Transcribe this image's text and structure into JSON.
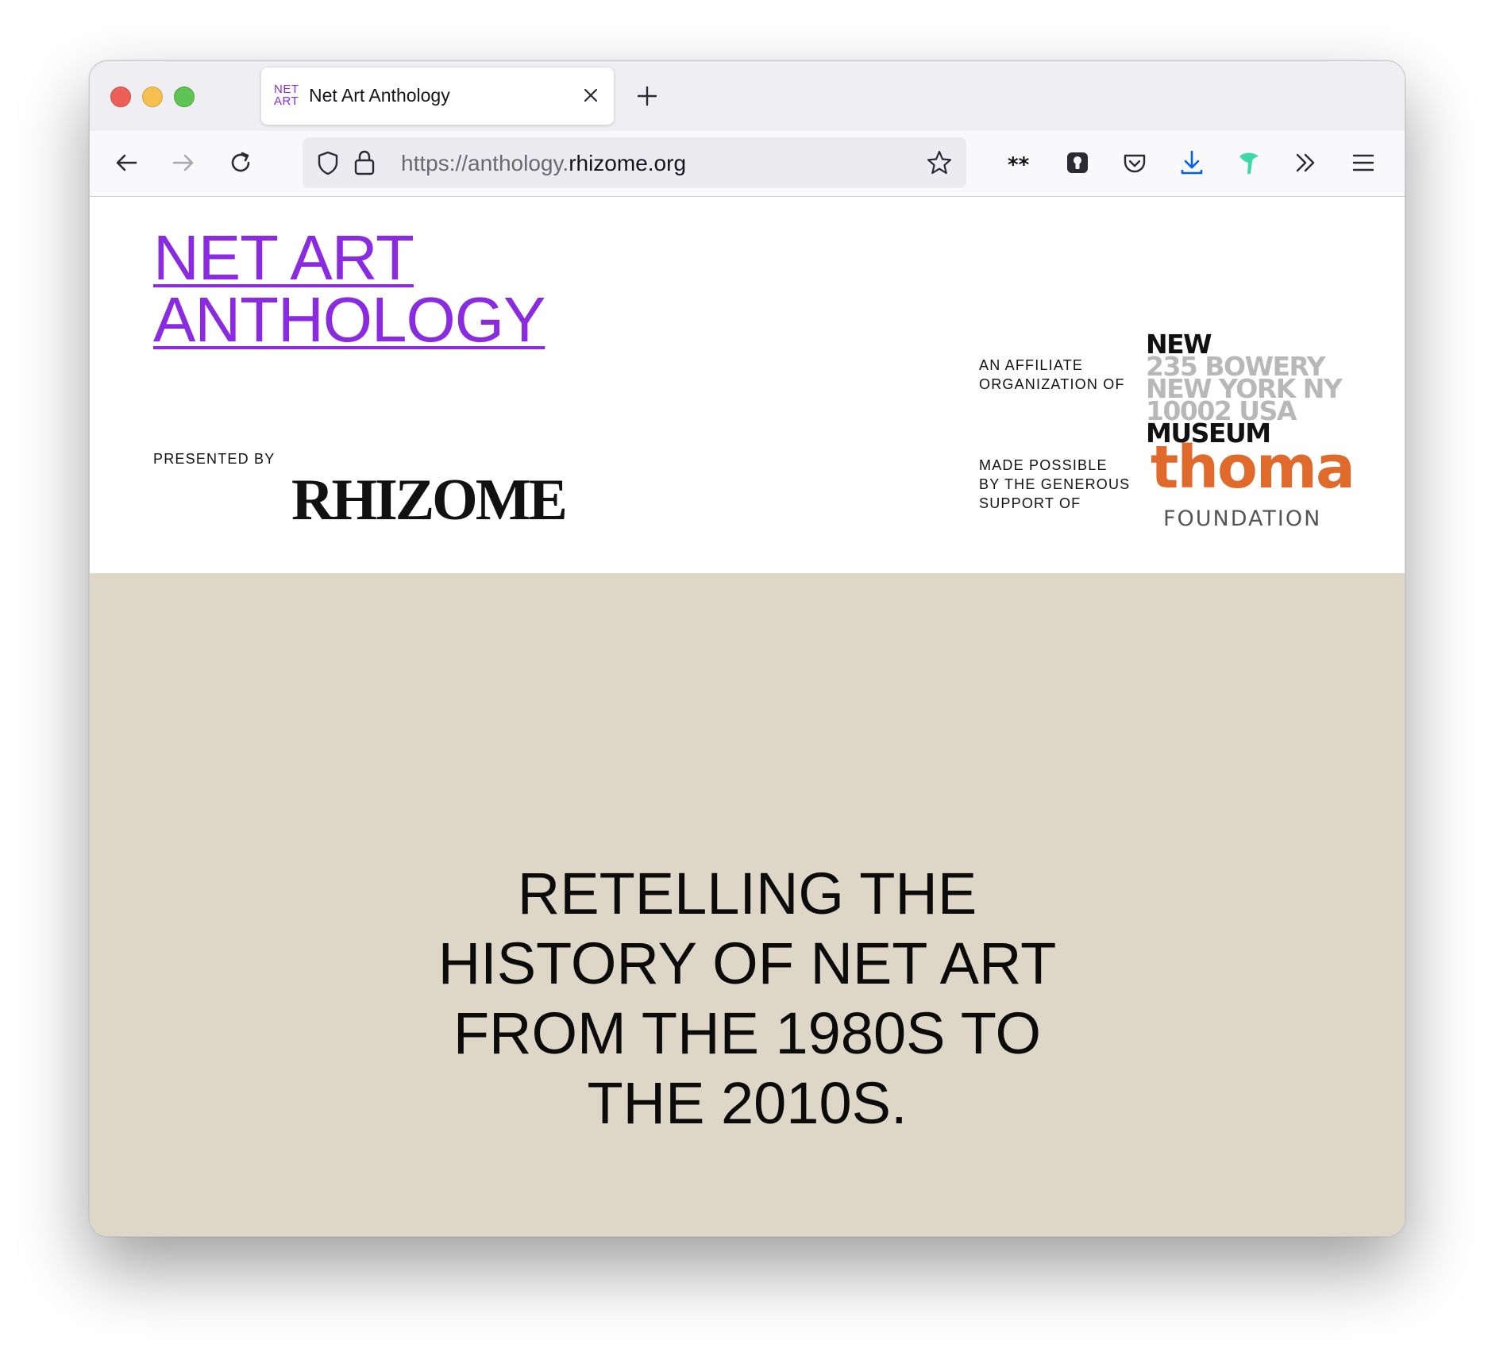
{
  "browser": {
    "tab": {
      "favicon_line1": "NET",
      "favicon_line2": "ART",
      "title": "Net Art Anthology"
    },
    "url": {
      "prefix": "https://anthology.",
      "host": "rhizome.org"
    },
    "icons": [
      "back-icon",
      "forward-icon",
      "reload-icon",
      "shield-icon",
      "lock-icon",
      "star-icon",
      "extension-asterisks-icon",
      "password-manager-icon",
      "pocket-icon",
      "downloads-icon",
      "extension-bird-icon",
      "overflow-chevrons-icon",
      "menu-icon"
    ],
    "colors": {
      "accent_download": "#0061e0",
      "extension_bird": "#3fd9a7"
    }
  },
  "page": {
    "title_line1": "NET ART",
    "title_line2": "ANTHOLOGY",
    "presented_by": "PRESENTED BY",
    "rhizome_logo": "RHIZOME",
    "affiliate_line1": "AN AFFILIATE",
    "affiliate_line2": "ORGANIZATION OF",
    "new_museum": {
      "line1": "NEW",
      "line2": "235 BOWERY",
      "line3": "NEW YORK NY",
      "line4": "10002 USA",
      "line5": "MUSEUM"
    },
    "support_line1": "MADE POSSIBLE",
    "support_line2": "BY THE GENEROUS",
    "support_line3": "SUPPORT OF",
    "thoma": {
      "word": "thoma",
      "foundation": "FOUNDATION"
    },
    "tagline_line1": "RETELLING THE",
    "tagline_line2": "HISTORY OF NET ART",
    "tagline_line3": "FROM THE 1980S TO",
    "tagline_line4": "THE 2010S.",
    "colors": {
      "title": "#8a2be2",
      "hero_background": "#ded7c8",
      "thoma_orange": "#e06a2c"
    }
  }
}
